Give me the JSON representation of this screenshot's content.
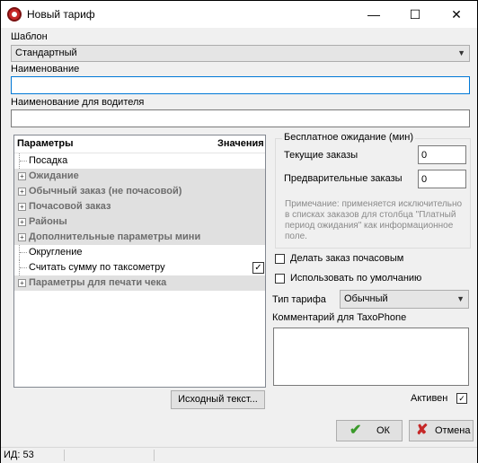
{
  "window": {
    "title": "Новый тариф",
    "minimize": "—",
    "maximize": "☐",
    "close": "✕"
  },
  "template": {
    "label": "Шаблон",
    "value": "Стандартный"
  },
  "name": {
    "label": "Наименование",
    "value": ""
  },
  "driver_name": {
    "label": "Наименование для водителя",
    "value": ""
  },
  "tree": {
    "col_params": "Параметры",
    "col_values": "Значения",
    "rows": [
      {
        "label": "Посадка",
        "group": false
      },
      {
        "label": "Ожидание",
        "group": true
      },
      {
        "label": "Обычный заказ (не почасовой)",
        "group": true
      },
      {
        "label": "Почасовой заказ",
        "group": true
      },
      {
        "label": "Районы",
        "group": true
      },
      {
        "label": "Дополнительные параметры мини",
        "group": true
      },
      {
        "label": "Округление",
        "group": false
      },
      {
        "label": "Считать сумму по таксометру",
        "group": false,
        "checked": true
      },
      {
        "label": "Параметры для печати чека",
        "group": true
      }
    ]
  },
  "free_wait": {
    "title": "Бесплатное ожидание (мин)",
    "current_label": "Текущие заказы",
    "current_value": "0",
    "preliminary_label": "Предварительные заказы",
    "preliminary_value": "0",
    "note": "Примечание: применяется исключительно в списках заказов для столбца \"Платный период ожидания\" как информационное поле."
  },
  "hourly": {
    "label": "Делать заказ почасовым",
    "checked": false
  },
  "default": {
    "label": "Использовать по умолчанию",
    "checked": false
  },
  "tariff_type": {
    "label": "Тип тарифа",
    "value": "Обычный"
  },
  "comment": {
    "label": "Комментарий для TaxoPhone",
    "value": ""
  },
  "source_button": "Исходный текст...",
  "active": {
    "label": "Активен",
    "checked": true
  },
  "ok_button": "ОК",
  "cancel_button": "Отмена",
  "status": {
    "id": "ИД: 53"
  },
  "colors": {
    "ok_check": "#3a9a2a",
    "cancel_x": "#c62828",
    "focus": "#0078d7"
  }
}
